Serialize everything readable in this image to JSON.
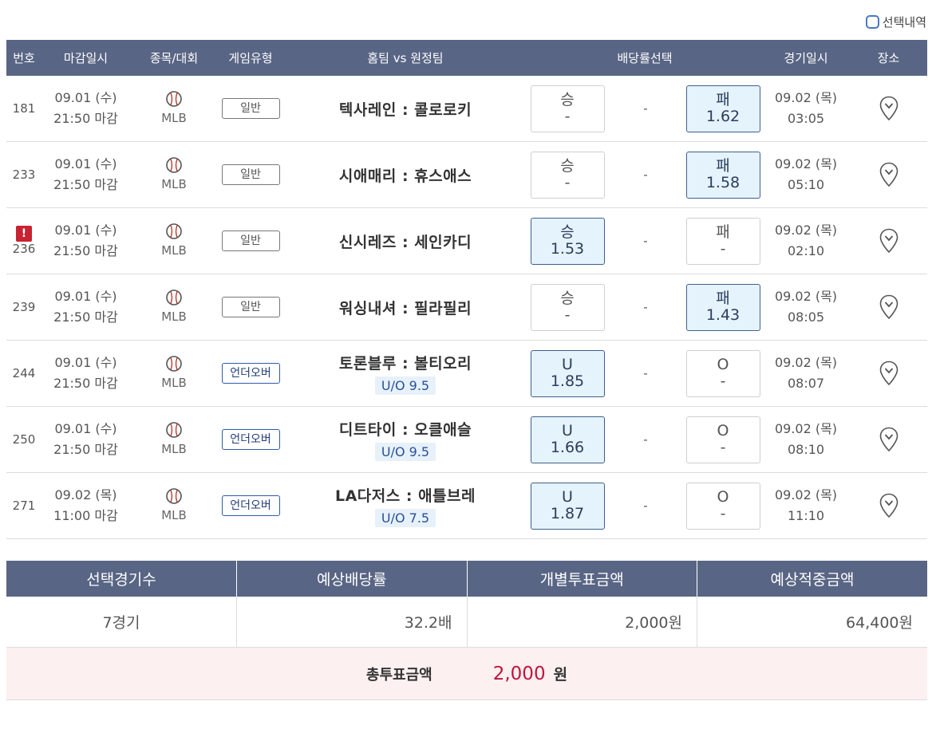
{
  "selection_label": "선택내역",
  "headers": [
    "번호",
    "마감일시",
    "종목/대회",
    "게임유형",
    "홈팀 vs 원정팀",
    "배당률선택",
    "",
    "",
    "경기일시",
    "장소"
  ],
  "rows": [
    {
      "num": "181",
      "alert": false,
      "close_date": "09.01 (수)",
      "close_time": "21:50 마감",
      "sport": "MLB",
      "type": "일반",
      "type_uo": false,
      "match": "텍사레인 : 콜로로키",
      "uo": "",
      "left_label": "승",
      "left_value": "-",
      "left_on": false,
      "mid": "-",
      "right_label": "패",
      "right_value": "1.62",
      "right_on": true,
      "game_date": "09.02 (목)",
      "game_time": "03:05"
    },
    {
      "num": "233",
      "alert": false,
      "close_date": "09.01 (수)",
      "close_time": "21:50 마감",
      "sport": "MLB",
      "type": "일반",
      "type_uo": false,
      "match": "시애매리 : 휴스애스",
      "uo": "",
      "left_label": "승",
      "left_value": "-",
      "left_on": false,
      "mid": "-",
      "right_label": "패",
      "right_value": "1.58",
      "right_on": true,
      "game_date": "09.02 (목)",
      "game_time": "05:10"
    },
    {
      "num": "236",
      "alert": true,
      "alert_symbol": "!",
      "close_date": "09.01 (수)",
      "close_time": "21:50 마감",
      "sport": "MLB",
      "type": "일반",
      "type_uo": false,
      "match": "신시레즈 : 세인카디",
      "uo": "",
      "left_label": "승",
      "left_value": "1.53",
      "left_on": true,
      "mid": "-",
      "right_label": "패",
      "right_value": "-",
      "right_on": false,
      "game_date": "09.02 (목)",
      "game_time": "02:10"
    },
    {
      "num": "239",
      "alert": false,
      "close_date": "09.01 (수)",
      "close_time": "21:50 마감",
      "sport": "MLB",
      "type": "일반",
      "type_uo": false,
      "match": "워싱내셔 : 필라필리",
      "uo": "",
      "left_label": "승",
      "left_value": "-",
      "left_on": false,
      "mid": "-",
      "right_label": "패",
      "right_value": "1.43",
      "right_on": true,
      "game_date": "09.02 (목)",
      "game_time": "08:05"
    },
    {
      "num": "244",
      "alert": false,
      "close_date": "09.01 (수)",
      "close_time": "21:50 마감",
      "sport": "MLB",
      "type": "언더오버",
      "type_uo": true,
      "match": "토론블루 : 볼티오리",
      "uo": "U/O 9.5",
      "left_label": "U",
      "left_value": "1.85",
      "left_on": true,
      "mid": "-",
      "right_label": "O",
      "right_value": "-",
      "right_on": false,
      "game_date": "09.02 (목)",
      "game_time": "08:07"
    },
    {
      "num": "250",
      "alert": false,
      "close_date": "09.01 (수)",
      "close_time": "21:50 마감",
      "sport": "MLB",
      "type": "언더오버",
      "type_uo": true,
      "match": "디트타이 : 오클애슬",
      "uo": "U/O 9.5",
      "left_label": "U",
      "left_value": "1.66",
      "left_on": true,
      "mid": "-",
      "right_label": "O",
      "right_value": "-",
      "right_on": false,
      "game_date": "09.02 (목)",
      "game_time": "08:10"
    },
    {
      "num": "271",
      "alert": false,
      "close_date": "09.02 (목)",
      "close_time": "11:00 마감",
      "sport": "MLB",
      "type": "언더오버",
      "type_uo": true,
      "match": "LA다저스 : 애틀브레",
      "uo": "U/O 7.5",
      "left_label": "U",
      "left_value": "1.87",
      "left_on": true,
      "mid": "-",
      "right_label": "O",
      "right_value": "-",
      "right_on": false,
      "game_date": "09.02 (목)",
      "game_time": "11:10"
    }
  ],
  "summary": {
    "headers": [
      "선택경기수",
      "예상배당률",
      "개별투표금액",
      "예상적중금액"
    ],
    "games": "7경기",
    "odds": "32.2배",
    "bet": "2,000원",
    "payout": "64,400원"
  },
  "total": {
    "label": "총투표금액",
    "value": "2,000",
    "unit": "원"
  },
  "colors": {
    "header_bg": "#596584",
    "selected_bg": "#e5f3fc",
    "total_bg": "#fcf0f1",
    "total_value": "#c0143c",
    "alert": "#c82333"
  },
  "icons": {
    "sport": "baseball-icon",
    "location": "map-pin-icon",
    "alert": "alert-icon",
    "checkbox": "checkbox-icon"
  }
}
